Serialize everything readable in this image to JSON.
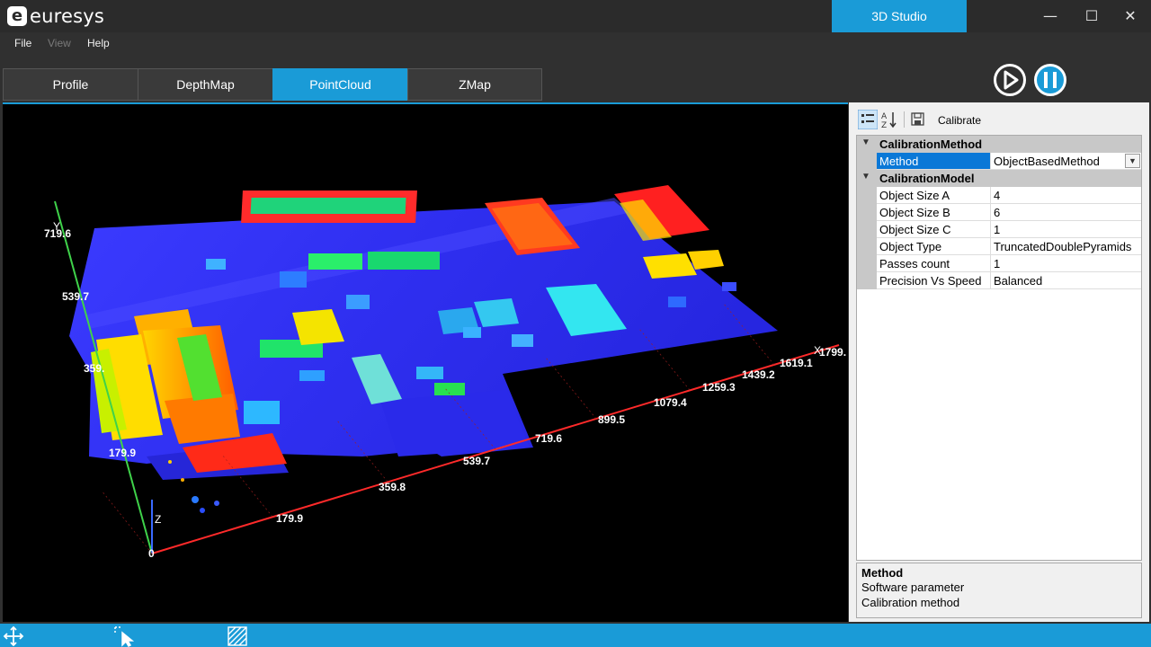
{
  "app": {
    "brand": "euresys",
    "brand_mark": "e",
    "studio_tab": "3D Studio"
  },
  "window_controls": {
    "minimize": "—",
    "maximize": "☐",
    "close": "✕"
  },
  "menu": {
    "file": "File",
    "view": "View",
    "help": "Help"
  },
  "tabs": [
    {
      "label": "Profile",
      "active": false
    },
    {
      "label": "DepthMap",
      "active": false
    },
    {
      "label": "PointCloud",
      "active": true
    },
    {
      "label": "ZMap",
      "active": false
    }
  ],
  "viewport": {
    "x_axis_ticks": [
      "0",
      "179.9",
      "359.8",
      "539.7",
      "719.6",
      "899.5",
      "1079.4",
      "1259.3",
      "1439.2",
      "1619.1",
      "1799."
    ],
    "y_axis_ticks": [
      "179.9",
      "359.",
      "539.7",
      "719.6"
    ],
    "z_label": "Z",
    "y_label": "Y",
    "x_label": "X"
  },
  "properties": {
    "toolbar": {
      "calibrate_label": "Calibrate",
      "categorized_icon": "categorized-icon",
      "alphabetical_icon": "sort-az-icon",
      "save_icon": "save-icon"
    },
    "categories": [
      {
        "name": "CalibrationMethod",
        "rows": [
          {
            "name": "Method",
            "value": "ObjectBasedMethod",
            "selected": true,
            "dropdown": true
          }
        ]
      },
      {
        "name": "CalibrationModel",
        "rows": [
          {
            "name": "Object Size A",
            "value": "4"
          },
          {
            "name": "Object Size B",
            "value": "6"
          },
          {
            "name": "Object Size C",
            "value": "1"
          },
          {
            "name": "Object Type",
            "value": "TruncatedDoublePyramids"
          },
          {
            "name": "Passes count",
            "value": "1"
          },
          {
            "name": "Precision Vs Speed",
            "value": "Balanced"
          }
        ]
      }
    ],
    "description": {
      "title": "Method",
      "line1": "Software parameter",
      "line2": "Calibration method"
    }
  },
  "statusbar": {
    "icons": [
      "move-icon",
      "select-cursor-icon",
      "hatch-area-icon"
    ]
  },
  "colors": {
    "accent": "#1a9bd7",
    "background": "#303030",
    "selection": "#0a78d7"
  }
}
